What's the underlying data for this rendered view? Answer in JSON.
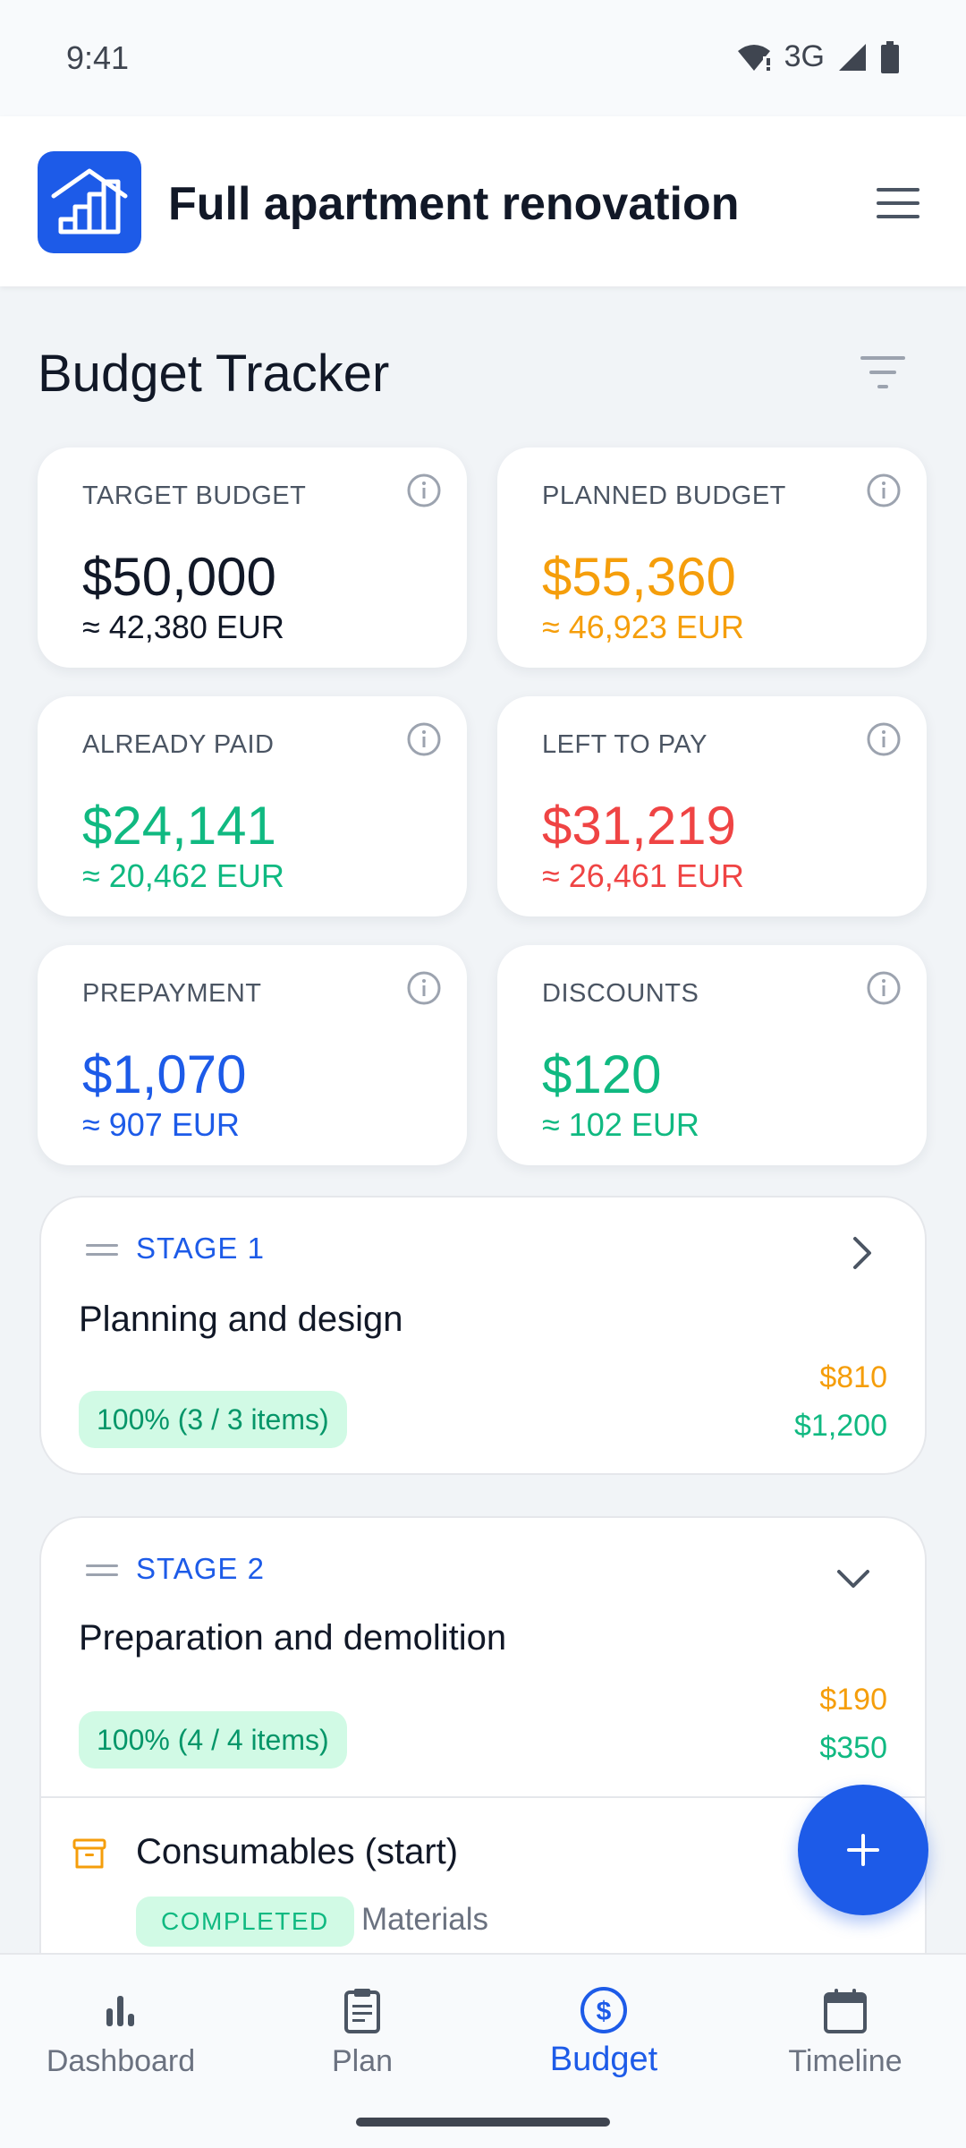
{
  "status": {
    "time": "9:41",
    "network": "3G"
  },
  "header": {
    "title": "Full apartment renovation"
  },
  "page": {
    "title": "Budget Tracker"
  },
  "colors": {
    "primary": "#1d5be8",
    "planned": "#f59e0b",
    "paid": "#10b981",
    "left": "#ef4444",
    "text": "#111827"
  },
  "cards": [
    {
      "label": "TARGET BUDGET",
      "value": "$50,000",
      "sub": "≈ 42,380 EUR"
    },
    {
      "label": "PLANNED BUDGET",
      "value": "$55,360",
      "sub": "≈ 46,923 EUR"
    },
    {
      "label": "ALREADY PAID",
      "value": "$24,141",
      "sub": "≈ 20,462 EUR"
    },
    {
      "label": "LEFT TO PAY",
      "value": "$31,219",
      "sub": "≈ 26,461 EUR"
    },
    {
      "label": "PREPAYMENT",
      "value": "$1,070",
      "sub": "≈ 907 EUR"
    },
    {
      "label": "DISCOUNTS",
      "value": "$120",
      "sub": "≈ 102 EUR"
    }
  ],
  "stages": [
    {
      "label": "STAGE 1",
      "name": "Planning and design",
      "progress": "100% (3 / 3 items)",
      "planned": "$810",
      "actual": "$1,200",
      "expanded": false
    },
    {
      "label": "STAGE 2",
      "name": "Preparation and demolition",
      "progress": "100% (4 / 4 items)",
      "planned": "$190",
      "actual": "$350",
      "expanded": true,
      "items": [
        {
          "name": "Consumables (start)",
          "status": "COMPLETED",
          "category": "Materials"
        }
      ]
    }
  ],
  "nav": [
    {
      "label": "Dashboard",
      "icon": "bar-chart-icon",
      "active": false
    },
    {
      "label": "Plan",
      "icon": "clipboard-icon",
      "active": false
    },
    {
      "label": "Budget",
      "icon": "dollar-circle-icon",
      "active": true
    },
    {
      "label": "Timeline",
      "icon": "calendar-icon",
      "active": false
    }
  ]
}
